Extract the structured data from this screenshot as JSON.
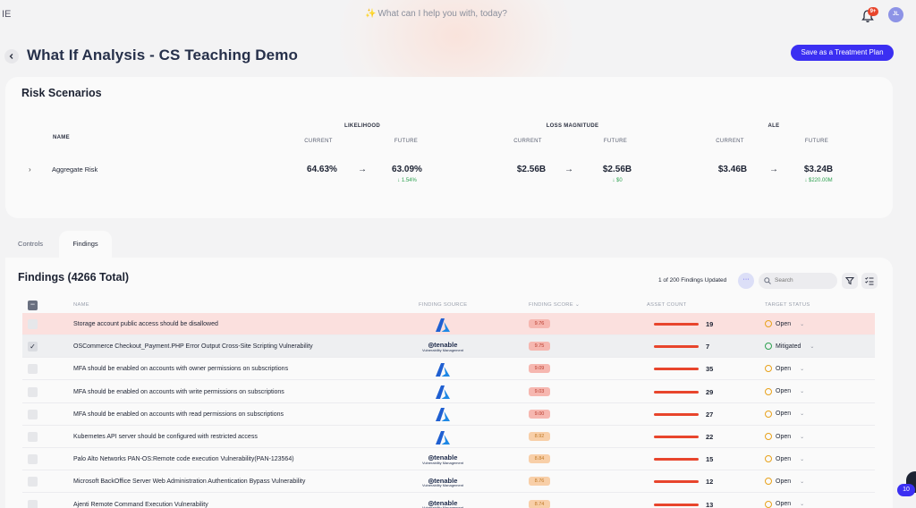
{
  "topbar": {
    "logo_fragment": "IE",
    "ask_placeholder": "What can I help you with, today?",
    "notification_badge": "9+",
    "avatar_initials": "JL"
  },
  "header": {
    "title": "What If Analysis - CS Teaching Demo",
    "treatment_button": "Save as a Treatment Plan"
  },
  "risk": {
    "title": "Risk Scenarios",
    "name_header": "NAME",
    "groups": [
      "LIKELIHOOD",
      "LOSS MAGNITUDE",
      "ALE"
    ],
    "current_label": "CURRENT",
    "future_label": "FUTURE",
    "row": {
      "name": "Aggregate Risk",
      "likelihood_current": "64.63%",
      "likelihood_future": "63.09%",
      "likelihood_delta": "↓ 1.54%",
      "loss_current": "$2.56B",
      "loss_future": "$2.56B",
      "loss_delta": "↓ $0",
      "ale_current": "$3.46B",
      "ale_future": "$3.24B",
      "ale_delta": "↓ $220.00M"
    }
  },
  "tabs": [
    {
      "label": "Controls"
    },
    {
      "label": "Findings"
    }
  ],
  "findings": {
    "title": "Findings (4266 Total)",
    "updated_text": "1 of 200 Findings Updated",
    "search_placeholder": "Search",
    "columns": {
      "name": "NAME",
      "source": "FINDING SOURCE",
      "score": "FINDING SCORE",
      "asset_count": "ASSET COUNT",
      "target_status": "TARGET STATUS"
    },
    "tenable_brand": "tenable",
    "tenable_sub": "Vulnerability Management",
    "rows": [
      {
        "name": "Storage account public access should be disallowed",
        "source": "azure",
        "score": "9.76",
        "score_color": "#f6b7b0",
        "assets": "19",
        "status": "Open",
        "checked": false
      },
      {
        "name": "OSCommerce Checkout_Payment.PHP Error Output Cross-Site Scripting Vulnerability",
        "source": "tenable",
        "score": "9.75",
        "score_color": "#f6b7b0",
        "assets": "7",
        "status": "Mitigated",
        "checked": true
      },
      {
        "name": "MFA should be enabled on accounts with owner permissions on subscriptions",
        "source": "azure",
        "score": "9.09",
        "score_color": "#f6b7b0",
        "assets": "35",
        "status": "Open",
        "checked": false
      },
      {
        "name": "MFA should be enabled on accounts with write permissions on subscriptions",
        "source": "azure",
        "score": "9.03",
        "score_color": "#f6b7b0",
        "assets": "29",
        "status": "Open",
        "checked": false
      },
      {
        "name": "MFA should be enabled on accounts with read permissions on subscriptions",
        "source": "azure",
        "score": "9.00",
        "score_color": "#f6b7b0",
        "assets": "27",
        "status": "Open",
        "checked": false
      },
      {
        "name": "Kubernetes API server should be configured with restricted access",
        "source": "azure",
        "score": "8.92",
        "score_color": "#f8cfa8",
        "assets": "22",
        "status": "Open",
        "checked": false
      },
      {
        "name": "Palo Alto Networks PAN-OS:Remote code execution Vulnerability(PAN-123564)",
        "source": "tenable",
        "score": "8.84",
        "score_color": "#f8cfa8",
        "assets": "15",
        "status": "Open",
        "checked": false
      },
      {
        "name": "Microsoft BackOffice Server Web Administration Authentication Bypass Vulnerability",
        "source": "tenable",
        "score": "8.76",
        "score_color": "#f8cfa8",
        "assets": "12",
        "status": "Open",
        "checked": false
      },
      {
        "name": "Ajenti Remote Command Execution Vulnerability",
        "source": "tenable",
        "score": "8.74",
        "score_color": "#f8cfa8",
        "assets": "13",
        "status": "Open",
        "checked": false
      }
    ]
  },
  "chat_count": "10",
  "colors": {
    "accent": "#3b2ff2",
    "danger": "#e8452c",
    "success": "#2ea050",
    "warning": "#e8a21b"
  }
}
